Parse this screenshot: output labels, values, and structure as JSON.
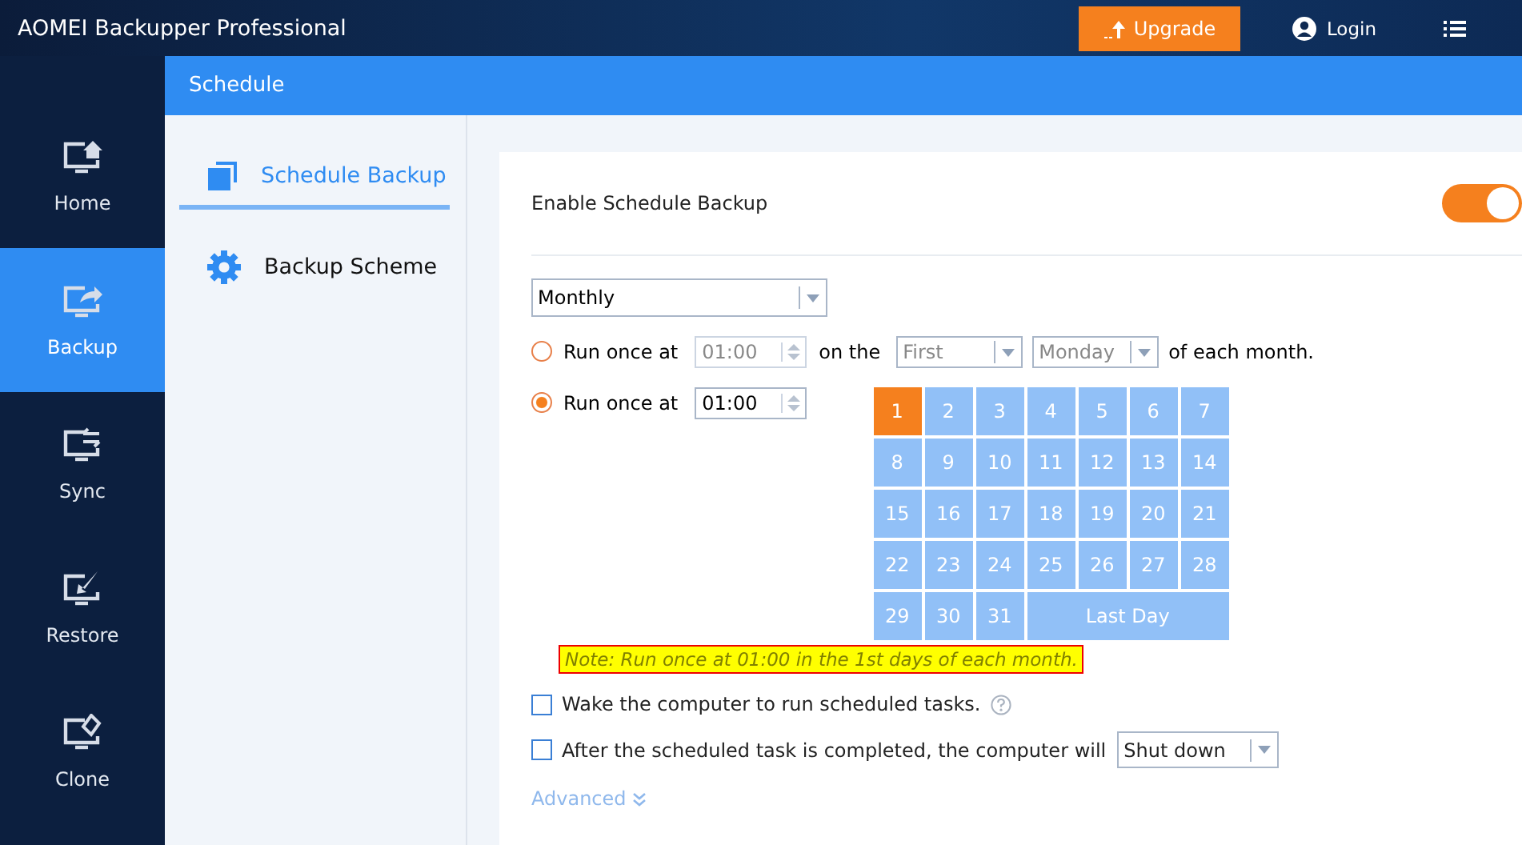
{
  "window": {
    "title": "AOMEI Backupper Professional"
  },
  "top_bar": {
    "upgrade": "Upgrade",
    "login": "Login"
  },
  "nav": [
    {
      "label": "Home",
      "kind": "home",
      "selected": false
    },
    {
      "label": "Backup",
      "kind": "backup",
      "selected": true
    },
    {
      "label": "Sync",
      "kind": "sync",
      "selected": false
    },
    {
      "label": "Restore",
      "kind": "restore",
      "selected": false
    },
    {
      "label": "Clone",
      "kind": "clone",
      "selected": false
    }
  ],
  "header": "Schedule",
  "side_tabs": [
    {
      "label": "Schedule Backup",
      "kind": "copy",
      "selected": true
    },
    {
      "label": "Backup Scheme",
      "kind": "gear",
      "selected": false
    }
  ],
  "enable": {
    "label": "Enable Schedule Backup",
    "on": true
  },
  "frequency": "Monthly",
  "options": [
    {
      "kind": "weekday",
      "selected": false,
      "label": "Run once at",
      "time": "01:00",
      "on_the": "on the",
      "ordinal": "First",
      "weekday": "Monday",
      "suffix": "of each month."
    },
    {
      "kind": "days",
      "selected": true,
      "label": "Run once at",
      "time": "01:00"
    }
  ],
  "days": [
    {
      "label": "1",
      "selected": true
    },
    {
      "label": "2",
      "selected": false
    },
    {
      "label": "3",
      "selected": false
    },
    {
      "label": "4",
      "selected": false
    },
    {
      "label": "5",
      "selected": false
    },
    {
      "label": "6",
      "selected": false
    },
    {
      "label": "7",
      "selected": false
    },
    {
      "label": "8",
      "selected": false
    },
    {
      "label": "9",
      "selected": false
    },
    {
      "label": "10",
      "selected": false
    },
    {
      "label": "11",
      "selected": false
    },
    {
      "label": "12",
      "selected": false
    },
    {
      "label": "13",
      "selected": false
    },
    {
      "label": "14",
      "selected": false
    },
    {
      "label": "15",
      "selected": false
    },
    {
      "label": "16",
      "selected": false
    },
    {
      "label": "17",
      "selected": false
    },
    {
      "label": "18",
      "selected": false
    },
    {
      "label": "19",
      "selected": false
    },
    {
      "label": "20",
      "selected": false
    },
    {
      "label": "21",
      "selected": false
    },
    {
      "label": "22",
      "selected": false
    },
    {
      "label": "23",
      "selected": false
    },
    {
      "label": "24",
      "selected": false
    },
    {
      "label": "25",
      "selected": false
    },
    {
      "label": "26",
      "selected": false
    },
    {
      "label": "27",
      "selected": false
    },
    {
      "label": "28",
      "selected": false
    },
    {
      "label": "29",
      "selected": false
    },
    {
      "label": "30",
      "selected": false
    },
    {
      "label": "31",
      "selected": false
    },
    {
      "label": "Last Day",
      "selected": false,
      "wide": true
    }
  ],
  "note": "Note: Run once at 01:00 in the 1st days of each month.",
  "checks": [
    {
      "label": "Wake the computer to run scheduled tasks.",
      "checked": false,
      "help": true
    },
    {
      "label": "After the scheduled task is completed, the computer will",
      "checked": false,
      "select": "Shut down"
    }
  ],
  "advanced": "Advanced"
}
